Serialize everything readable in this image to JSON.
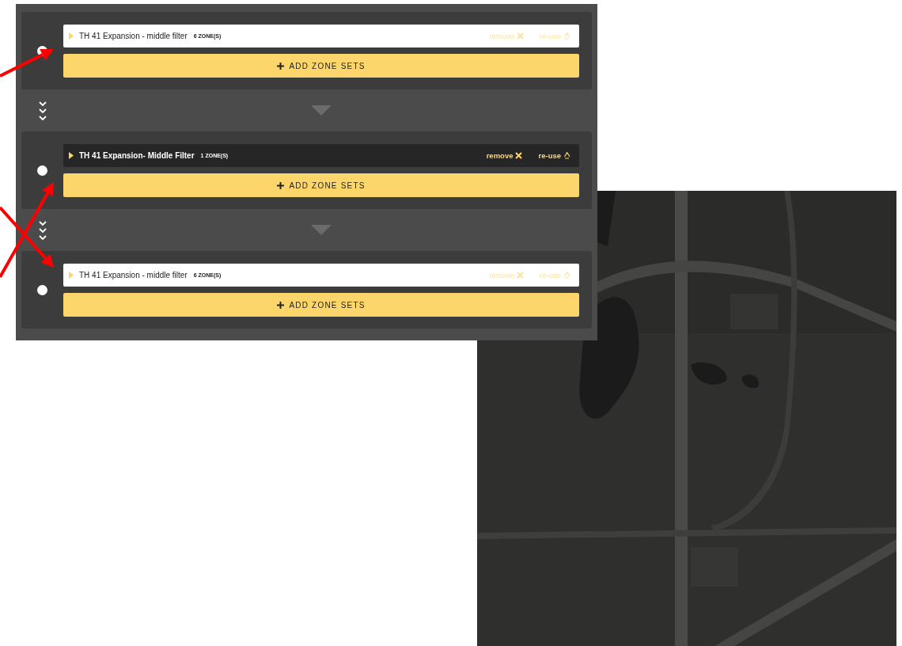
{
  "filters": [
    {
      "name": "TH 41 Expansion - middle filter",
      "count": "6 ZONE(S)",
      "selected": false,
      "remove": "remove",
      "reuse": "re-use",
      "add_button": "ADD ZONE SETS"
    },
    {
      "name": "TH 41 Expansion- Middle Filter",
      "count": "1 ZONE(S)",
      "selected": true,
      "remove": "remove",
      "reuse": "re-use",
      "add_button": "ADD ZONE SETS"
    },
    {
      "name": "TH 41 Expansion - middle filter",
      "count": "6 ZONE(S)",
      "selected": false,
      "remove": "remove",
      "reuse": "re-use",
      "add_button": "ADD ZONE SETS"
    }
  ]
}
